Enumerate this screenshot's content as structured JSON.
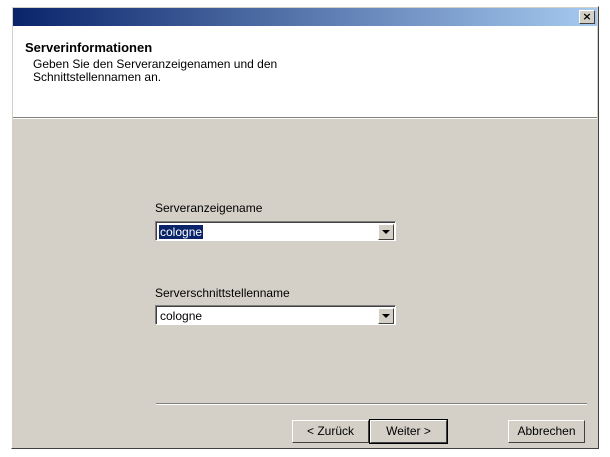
{
  "window": {
    "close_glyph": "×"
  },
  "header": {
    "title": "Serverinformationen",
    "subtitle": "Geben Sie den Serveranzeigenamen und den Schnittstellennamen an."
  },
  "fields": [
    {
      "label": "Serveranzeigename",
      "value": "cologne",
      "selected": true
    },
    {
      "label": "Serverschnittstellenname",
      "value": "cologne",
      "selected": false
    }
  ],
  "buttons": {
    "back": "< Zurück",
    "next": "Weiter >",
    "cancel": "Abbrechen"
  },
  "colors": {
    "titlebar_start": "#0a246a",
    "titlebar_end": "#a6caf0",
    "dialog_face": "#d4d0c8",
    "selection": "#0a246a"
  }
}
